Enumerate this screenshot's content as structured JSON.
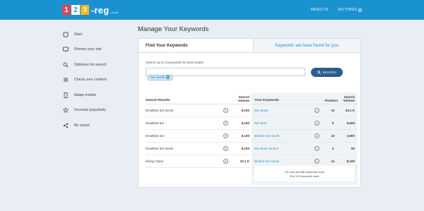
{
  "header": {
    "logo": {
      "one": "1",
      "two": "2",
      "three": "3",
      "word": "-reg",
      "tld": ".co.uk"
    },
    "nav": {
      "results": "RESULTS",
      "settings": "SETTINGS"
    }
  },
  "sidebar": {
    "items": [
      {
        "label": "Start",
        "icon": "square-icon"
      },
      {
        "label": "Review your site",
        "icon": "monitor-icon"
      },
      {
        "label": "Optimise for search",
        "icon": "search-icon"
      },
      {
        "label": "Check your content",
        "icon": "list-icon"
      },
      {
        "label": "Adapt mobile",
        "icon": "mobile-icon"
      },
      {
        "label": "Increase popularity",
        "icon": "star-icon"
      },
      {
        "label": "Be social",
        "icon": "share-icon"
      }
    ]
  },
  "page": {
    "title": "Manage Your Keywords"
  },
  "tabs": {
    "find": "Find Your Keywords",
    "found": "Keywords we have found for you"
  },
  "search": {
    "hint": "Search up to 3 keywords for best results",
    "chip": "bar stools",
    "button": "SEARCH"
  },
  "results": {
    "header": {
      "label": "Search Results",
      "volume_line1": "Search",
      "volume_line2": "Volume"
    },
    "rows": [
      {
        "keyword": "breakfast bar stools",
        "volume": "8,100"
      },
      {
        "keyword": "breakfast bar",
        "volume": "8,100"
      },
      {
        "keyword": "breakfast bar",
        "volume": "8,100"
      },
      {
        "keyword": "breakfast bar stools",
        "volume": "8,100"
      },
      {
        "keyword": "dining chairs",
        "volume": "33.1 K"
      }
    ]
  },
  "yours": {
    "header": {
      "label": "Your Keywords",
      "position": "Position",
      "volume_line1": "Search",
      "volume_line2": "Volume"
    },
    "rows": [
      {
        "keyword": "bar stools",
        "position": "10",
        "volume": "33.1 K"
      },
      {
        "keyword": "bar stool",
        "position": "5",
        "volume": "6,600"
      },
      {
        "keyword": "kitchen bar stools",
        "position": "10",
        "volume": "3,600"
      },
      {
        "keyword": "bar stools london",
        "position": "3",
        "volume": "50"
      },
      {
        "keyword": "kitchen bar stools",
        "position": "14",
        "volume": "8,100"
      }
    ],
    "note": {
      "line1_pre": "You can add ",
      "line1_num": "10",
      "line1_post": " Keywords more",
      "line2_num": "5",
      "line2_post": " of 15 Keywords used"
    }
  },
  "colors": {
    "header": "#1a92d0",
    "accent": "#1a92d0",
    "button": "#2c5d8f",
    "background": "#e8eef3"
  }
}
